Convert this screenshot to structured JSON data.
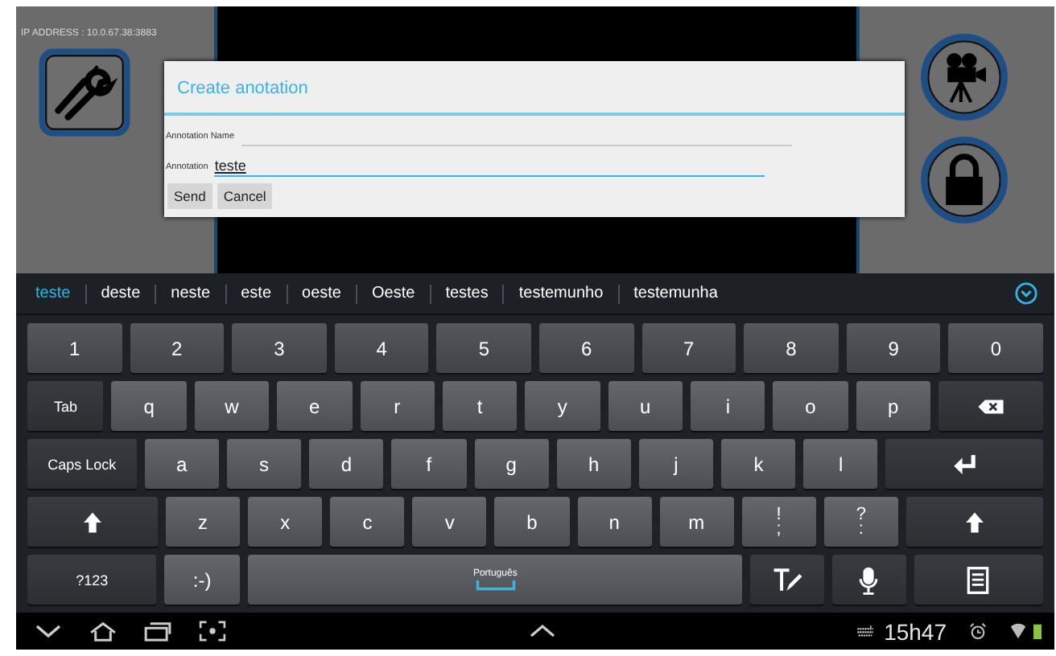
{
  "app": {
    "ip_address": "IP ADDRESS : 10.0.67.38:3883"
  },
  "dialog": {
    "title": "Create anotation",
    "fields": [
      {
        "label": "Annotation Name",
        "focused": false
      },
      {
        "label": "Annotation",
        "value": "teste",
        "focused": true
      }
    ],
    "buttons": [
      "Send",
      "Cancel"
    ]
  },
  "suggestions": [
    {
      "text": "teste",
      "selected": true
    },
    {
      "text": "deste",
      "selected": false
    },
    {
      "text": "neste",
      "selected": false
    },
    {
      "text": "este",
      "selected": false
    },
    {
      "text": "oeste",
      "selected": false
    },
    {
      "text": "Oeste",
      "selected": false
    },
    {
      "text": "testes",
      "selected": false
    },
    {
      "text": "testemunho",
      "selected": false
    },
    {
      "text": "testemunha",
      "selected": false
    }
  ],
  "keyboard": [
    [
      {
        "kind": "text",
        "label": "1"
      },
      {
        "kind": "text",
        "label": "2"
      },
      {
        "kind": "text",
        "label": "3"
      },
      {
        "kind": "text",
        "label": "4"
      },
      {
        "kind": "text",
        "label": "5"
      },
      {
        "kind": "text",
        "label": "6"
      },
      {
        "kind": "text",
        "label": "7"
      },
      {
        "kind": "text",
        "label": "8"
      },
      {
        "kind": "text",
        "label": "9"
      },
      {
        "kind": "text",
        "label": "0"
      }
    ],
    [
      {
        "kind": "func",
        "label": "Tab"
      },
      {
        "kind": "letter",
        "label": "q"
      },
      {
        "kind": "letter",
        "label": "w"
      },
      {
        "kind": "letter",
        "label": "e"
      },
      {
        "kind": "letter",
        "label": "r"
      },
      {
        "kind": "letter",
        "label": "t"
      },
      {
        "kind": "letter",
        "label": "y"
      },
      {
        "kind": "letter",
        "label": "u"
      },
      {
        "kind": "letter",
        "label": "i"
      },
      {
        "kind": "letter",
        "label": "o"
      },
      {
        "kind": "letter",
        "label": "p"
      },
      {
        "kind": "backspace"
      }
    ],
    [
      {
        "kind": "func",
        "label": "Caps Lock"
      },
      {
        "kind": "letter",
        "label": "a"
      },
      {
        "kind": "letter",
        "label": "s"
      },
      {
        "kind": "letter",
        "label": "d"
      },
      {
        "kind": "letter",
        "label": "f"
      },
      {
        "kind": "letter",
        "label": "g"
      },
      {
        "kind": "letter",
        "label": "h"
      },
      {
        "kind": "letter",
        "label": "j"
      },
      {
        "kind": "letter",
        "label": "k"
      },
      {
        "kind": "letter",
        "label": "l"
      },
      {
        "kind": "enter"
      }
    ],
    [
      {
        "kind": "shift"
      },
      {
        "kind": "letter",
        "label": "z"
      },
      {
        "kind": "letter",
        "label": "x"
      },
      {
        "kind": "letter",
        "label": "c"
      },
      {
        "kind": "letter",
        "label": "v"
      },
      {
        "kind": "letter",
        "label": "b"
      },
      {
        "kind": "letter",
        "label": "n"
      },
      {
        "kind": "letter",
        "label": "m"
      },
      {
        "kind": "dual",
        "label": "!",
        "sub": ";"
      },
      {
        "kind": "dual",
        "label": "?",
        "sub": ":"
      },
      {
        "kind": "shift"
      }
    ],
    [
      {
        "kind": "func",
        "label": "?123"
      },
      {
        "kind": "letter",
        "label": ":-)"
      },
      {
        "kind": "space",
        "label": "Português"
      },
      {
        "kind": "handwriting"
      },
      {
        "kind": "mic"
      },
      {
        "kind": "clipboard"
      }
    ]
  ],
  "status_bar": {
    "time": "15h47"
  }
}
